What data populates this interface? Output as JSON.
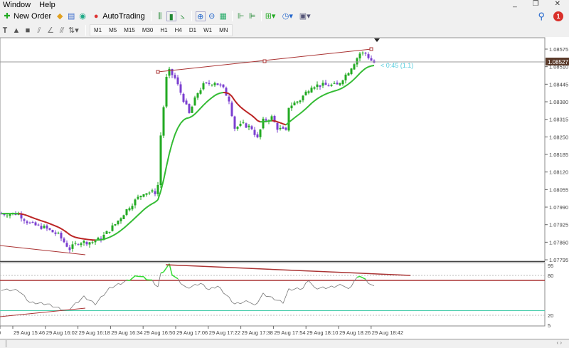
{
  "menu": [
    "Window",
    "Help"
  ],
  "toolbar": {
    "new_order": "New Order",
    "autotrading": "AutoTrading"
  },
  "timeframes": [
    "M1",
    "M5",
    "M15",
    "M30",
    "H1",
    "H4",
    "D1",
    "W1",
    "MN"
  ],
  "notification_count": "1",
  "price_axis": [
    "1.08575",
    "1.08510",
    "1.08445",
    "1.08380",
    "1.08315",
    "1.08250",
    "1.08185",
    "1.08120",
    "1.08055",
    "1.07990",
    "1.07925",
    "1.07860",
    "1.07795"
  ],
  "current_price": "1.08527",
  "countdown_label": "< 0:45 (1.1)",
  "rsi_axis": [
    "95",
    "80",
    "20",
    "5"
  ],
  "time_axis": [
    "0",
    "29 Aug 15:46",
    "29 Aug 16:02",
    "29 Aug 16:18",
    "29 Aug 16:34",
    "29 Aug 16:50",
    "29 Aug 17:06",
    "29 Aug 17:22",
    "29 Aug 17:38",
    "29 Aug 17:54",
    "29 Aug 18:10",
    "29 Aug 18:26",
    "29 Aug 18:42"
  ],
  "colors": {
    "bull": "#22aa22",
    "bear": "#7b3fd0",
    "ma_up": "#33bb33",
    "ma_down": "#bb2222",
    "trend": "#aa3333",
    "rsi": "#777777",
    "rsi_ob": "#33dd33",
    "level": "#44ccaa"
  },
  "chart_data": {
    "type": "candlestick",
    "symbol_note": "",
    "ylim": [
      1.07795,
      1.08575
    ],
    "price_keypoints": [
      [
        0,
        1.07966
      ],
      [
        6,
        1.07966
      ],
      [
        10,
        1.07927
      ],
      [
        15,
        1.07914
      ],
      [
        20,
        1.07887
      ],
      [
        24,
        1.07835
      ],
      [
        27,
        1.07861
      ],
      [
        32,
        1.07861
      ],
      [
        35,
        1.07874
      ],
      [
        40,
        1.07927
      ],
      [
        45,
        1.07993
      ],
      [
        50,
        1.08045
      ],
      [
        54,
        1.08045
      ],
      [
        55,
        1.08072
      ],
      [
        56,
        1.08256
      ],
      [
        58,
        1.08467
      ],
      [
        59,
        1.08493
      ],
      [
        61,
        1.08467
      ],
      [
        64,
        1.08388
      ],
      [
        66,
        1.08335
      ],
      [
        69,
        1.08414
      ],
      [
        71,
        1.08441
      ],
      [
        75,
        1.08454
      ],
      [
        78,
        1.08427
      ],
      [
        80,
        1.08388
      ],
      [
        82,
        1.08283
      ],
      [
        85,
        1.08296
      ],
      [
        88,
        1.08283
      ],
      [
        90,
        1.08243
      ],
      [
        92,
        1.08309
      ],
      [
        95,
        1.08322
      ],
      [
        97,
        1.08283
      ],
      [
        100,
        1.08269
      ],
      [
        101,
        1.08362
      ],
      [
        105,
        1.08388
      ],
      [
        109,
        1.08441
      ],
      [
        113,
        1.08441
      ],
      [
        118,
        1.08441
      ],
      [
        122,
        1.08493
      ],
      [
        126,
        1.08559
      ],
      [
        128,
        1.08559
      ],
      [
        130,
        1.08533
      ],
      [
        131,
        1.08525
      ]
    ],
    "rsi_keypoints": [
      [
        0,
        58.6
      ],
      [
        6,
        57.5
      ],
      [
        10,
        39.3
      ],
      [
        16,
        37
      ],
      [
        23,
        26.4
      ],
      [
        29,
        47.9
      ],
      [
        33,
        37
      ],
      [
        38,
        60.7
      ],
      [
        45,
        73.6
      ],
      [
        48,
        80
      ],
      [
        53,
        71.5
      ],
      [
        55,
        62.9
      ],
      [
        56,
        82
      ],
      [
        59,
        96
      ],
      [
        60,
        82
      ],
      [
        62,
        73.6
      ],
      [
        65,
        60.7
      ],
      [
        70,
        68
      ],
      [
        73,
        58.6
      ],
      [
        76,
        64
      ],
      [
        82,
        37
      ],
      [
        87,
        41.4
      ],
      [
        89,
        34
      ],
      [
        92,
        52
      ],
      [
        97,
        42.5
      ],
      [
        99,
        39.3
      ],
      [
        101,
        58.6
      ],
      [
        106,
        60.7
      ],
      [
        108,
        73.6
      ],
      [
        110,
        60.7
      ],
      [
        115,
        61.8
      ],
      [
        120,
        66
      ],
      [
        122,
        58.6
      ],
      [
        124,
        71.5
      ],
      [
        126,
        80
      ],
      [
        129,
        69.3
      ],
      [
        131,
        62.9
      ]
    ],
    "rsi_levels": [
      72.5,
      27
    ],
    "rsi_ylim": [
      5,
      95
    ]
  }
}
